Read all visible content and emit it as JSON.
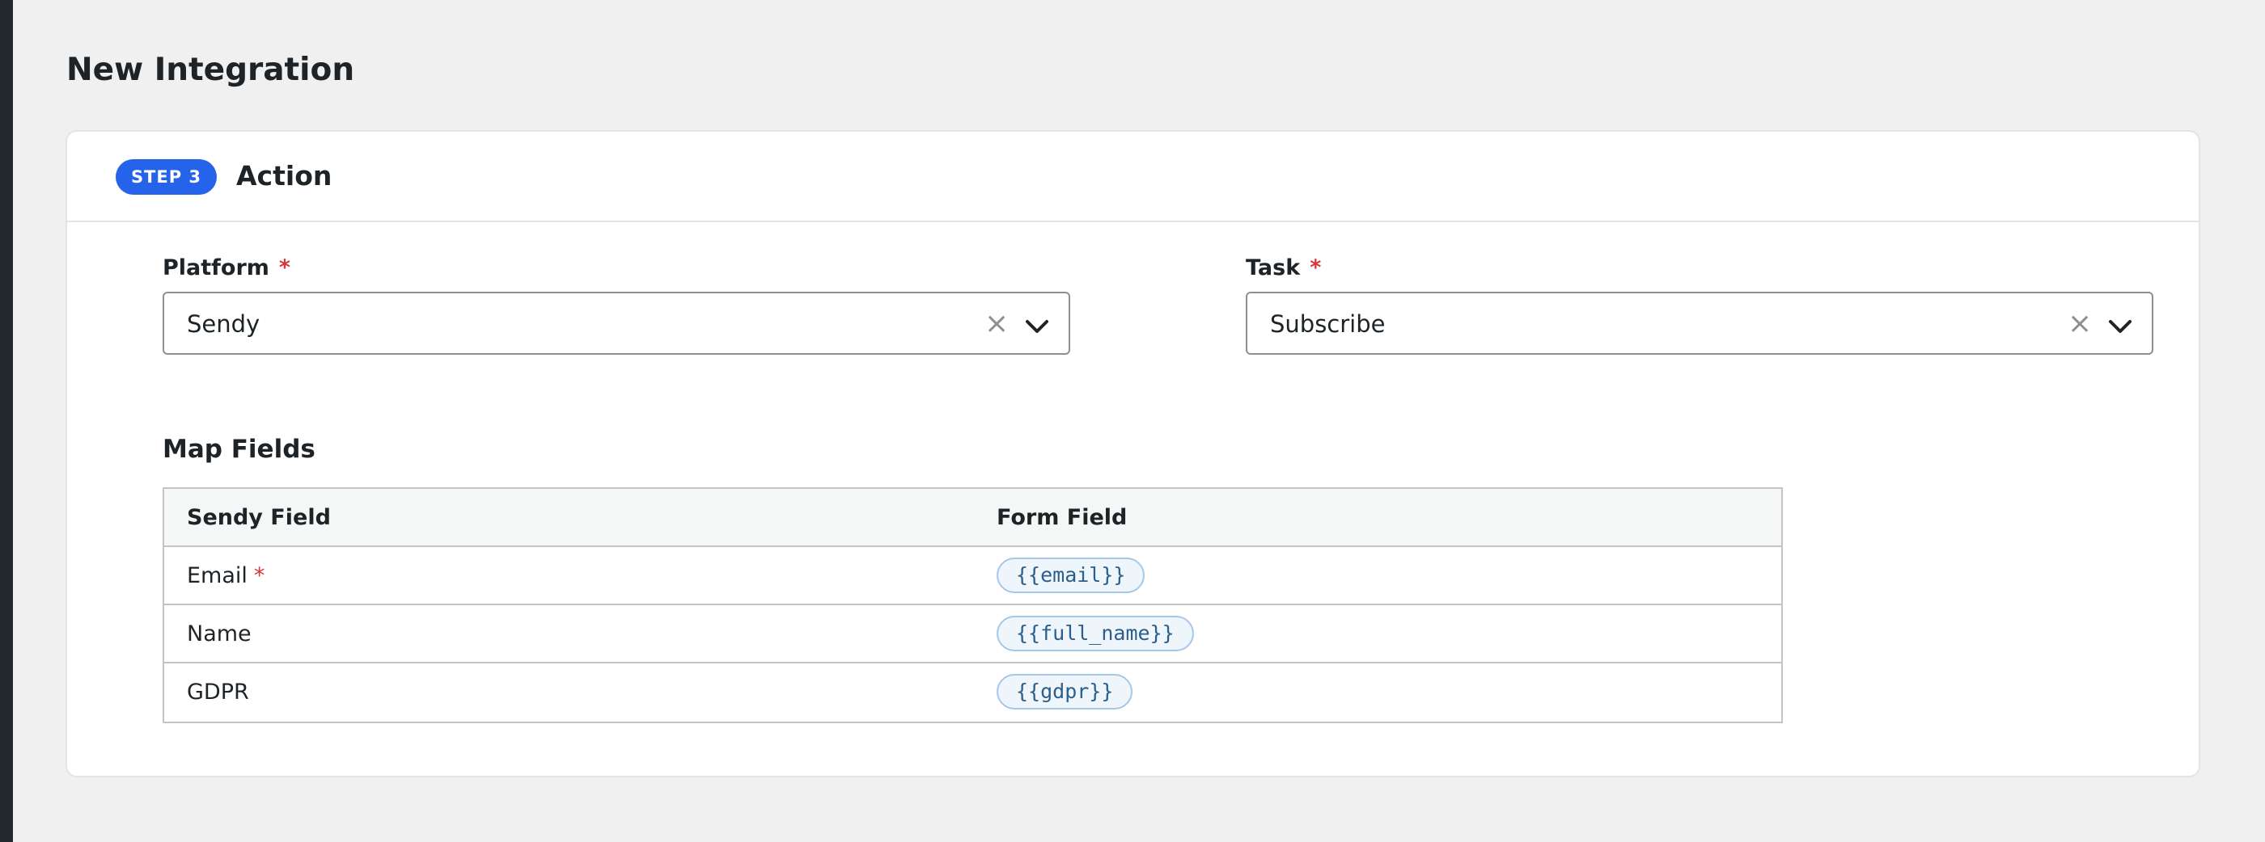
{
  "page": {
    "title": "New Integration"
  },
  "step": {
    "badge": "STEP 3",
    "title": "Action"
  },
  "platform": {
    "label": "Platform",
    "required_mark": "*",
    "value": "Sendy"
  },
  "task": {
    "label": "Task",
    "required_mark": "*",
    "value": "Subscribe"
  },
  "select_icons": {
    "clear": "×",
    "clear_icon": "close-icon",
    "open_icon": "chevron-down-icon"
  },
  "map_fields": {
    "title": "Map Fields",
    "columns": [
      "Sendy Field",
      "Form Field"
    ],
    "rows": [
      {
        "field": "Email",
        "required_mark": "*",
        "token": "{{email}}"
      },
      {
        "field": "Name",
        "token": "{{full_name}}"
      },
      {
        "field": "GDPR",
        "token": "{{gdpr}}"
      }
    ]
  },
  "colors": {
    "accent": "#2563eb",
    "required": "#d63638",
    "background": "#f0f0f1",
    "token_border": "#a6c8e8",
    "token_text": "#2c5e8c"
  }
}
